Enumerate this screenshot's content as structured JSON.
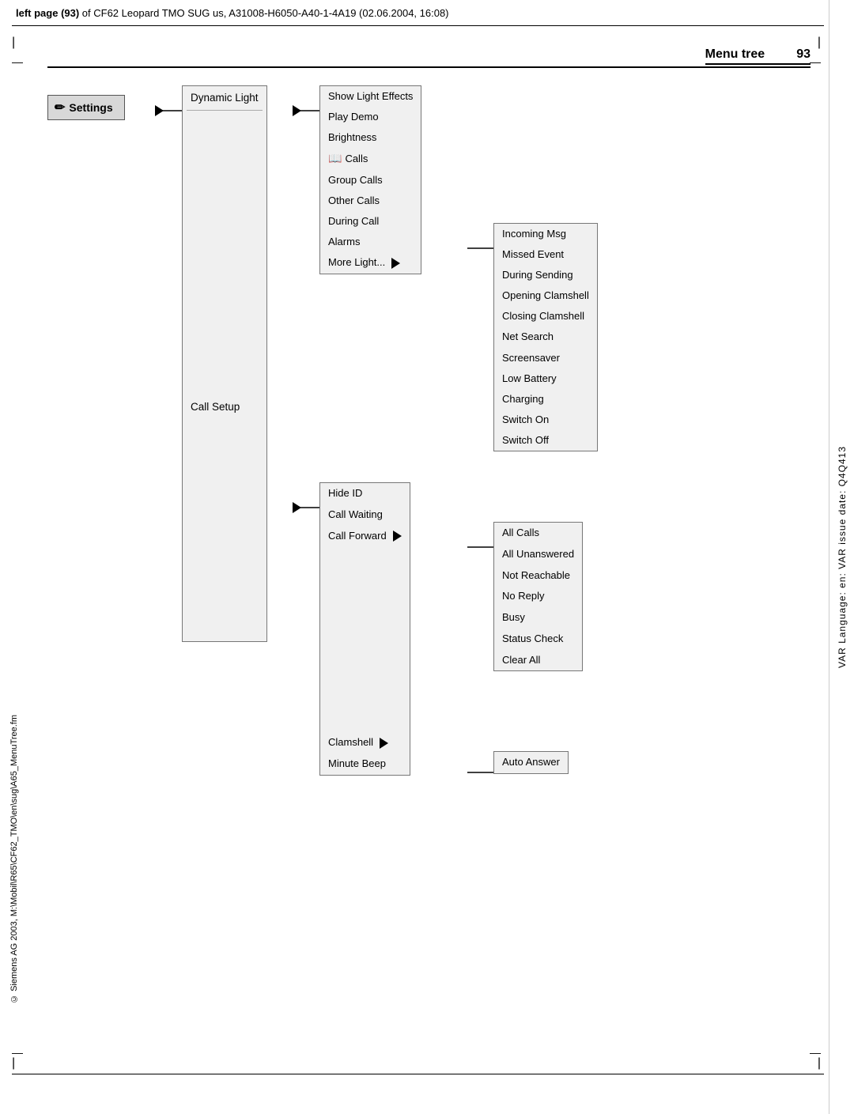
{
  "header": {
    "text_bold": "left page (93)",
    "text_rest": " of CF62 Leopard TMO SUG us, A31008-H6050-A40-1-4A19 (02.06.2004, 16:08)"
  },
  "right_bar": {
    "text": "VAR Language: en: VAR issue date: Q4Q413"
  },
  "page_title": {
    "label": "Menu tree",
    "number": "93"
  },
  "settings": {
    "label": "Settings",
    "icon": "✏"
  },
  "col1": {
    "items": [
      {
        "label": "Dynamic Light",
        "has_arrow": true
      },
      {
        "label": "Call Setup",
        "has_arrow": true
      }
    ]
  },
  "col2_dynamic_light": {
    "items": [
      {
        "label": "Show Light Effects",
        "has_icon": false
      },
      {
        "label": "Play Demo",
        "has_icon": false
      },
      {
        "label": "Brightness",
        "has_icon": false
      },
      {
        "label": "Calls",
        "has_icon": true,
        "icon": "📖"
      },
      {
        "label": "Group Calls",
        "has_icon": false
      },
      {
        "label": "Other Calls",
        "has_icon": false
      },
      {
        "label": "During Call",
        "has_icon": false
      },
      {
        "label": "Alarms",
        "has_icon": false
      },
      {
        "label": "More Light...",
        "has_arrow": true
      }
    ]
  },
  "col3_more_light": {
    "items": [
      {
        "label": "Incoming Msg"
      },
      {
        "label": "Missed Event"
      },
      {
        "label": "During Sending"
      },
      {
        "label": "Opening Clamshell"
      },
      {
        "label": "Closing Clamshell"
      },
      {
        "label": "Net Search"
      },
      {
        "label": "Screensaver"
      },
      {
        "label": "Low Battery"
      },
      {
        "label": "Charging"
      },
      {
        "label": "Switch On"
      },
      {
        "label": "Switch Off"
      }
    ]
  },
  "col4_call_setup": {
    "items": [
      {
        "label": "Hide ID",
        "has_arrow": false
      },
      {
        "label": "Call Waiting",
        "has_arrow": false
      },
      {
        "label": "Call Forward",
        "has_arrow": true
      },
      {
        "label": "Clamshell",
        "has_arrow": true
      },
      {
        "label": "Minute Beep",
        "has_arrow": false
      }
    ]
  },
  "col5_call_forward": {
    "items": [
      {
        "label": "All Calls"
      },
      {
        "label": "All Unanswered"
      },
      {
        "label": "Not Reachable"
      },
      {
        "label": "No Reply"
      },
      {
        "label": "Busy"
      },
      {
        "label": "Status Check"
      },
      {
        "label": "Clear All"
      }
    ]
  },
  "col6_clamshell": {
    "items": [
      {
        "label": "Auto Answer"
      }
    ]
  },
  "footer": {
    "text": "© Siemens AG 2003, M:\\Mobil\\R65\\CF62_TMO\\en\\sug\\A65_MenuTree.fm"
  }
}
